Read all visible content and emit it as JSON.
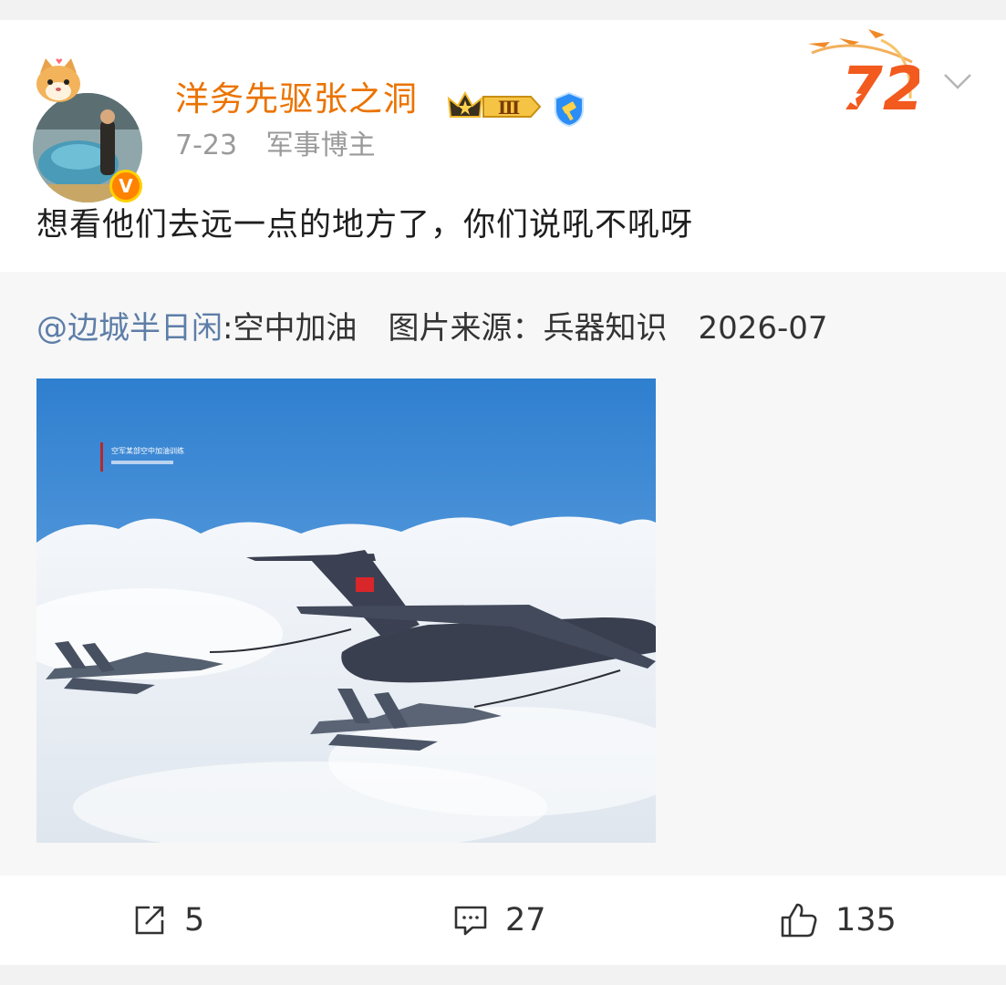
{
  "post": {
    "username": "洋务先驱张之洞",
    "date": "7-23",
    "role": "军事博主",
    "verified_badge": "V",
    "level_badge": "Ⅲ",
    "anniversary_badge": "72",
    "content": "想看他们去远一点的地方了，你们说吼不吼呀"
  },
  "repost": {
    "author": "@边城半日闲",
    "text_a": ":空中加油",
    "text_b": "图片来源：兵器知识",
    "text_c": "2026-07",
    "image_caption": "空军某部空中加油训练"
  },
  "actions": {
    "share_count": "5",
    "comment_count": "27",
    "like_count": "135"
  },
  "colors": {
    "username": "#eb7300",
    "mention": "#5d7ea8",
    "badge_orange": "#ff8200"
  },
  "icons": [
    "v-badge-icon",
    "crown-level-icon",
    "verified-icon",
    "anniversary-72-icon",
    "chevron-down-icon",
    "share-icon",
    "comment-icon",
    "like-icon"
  ]
}
